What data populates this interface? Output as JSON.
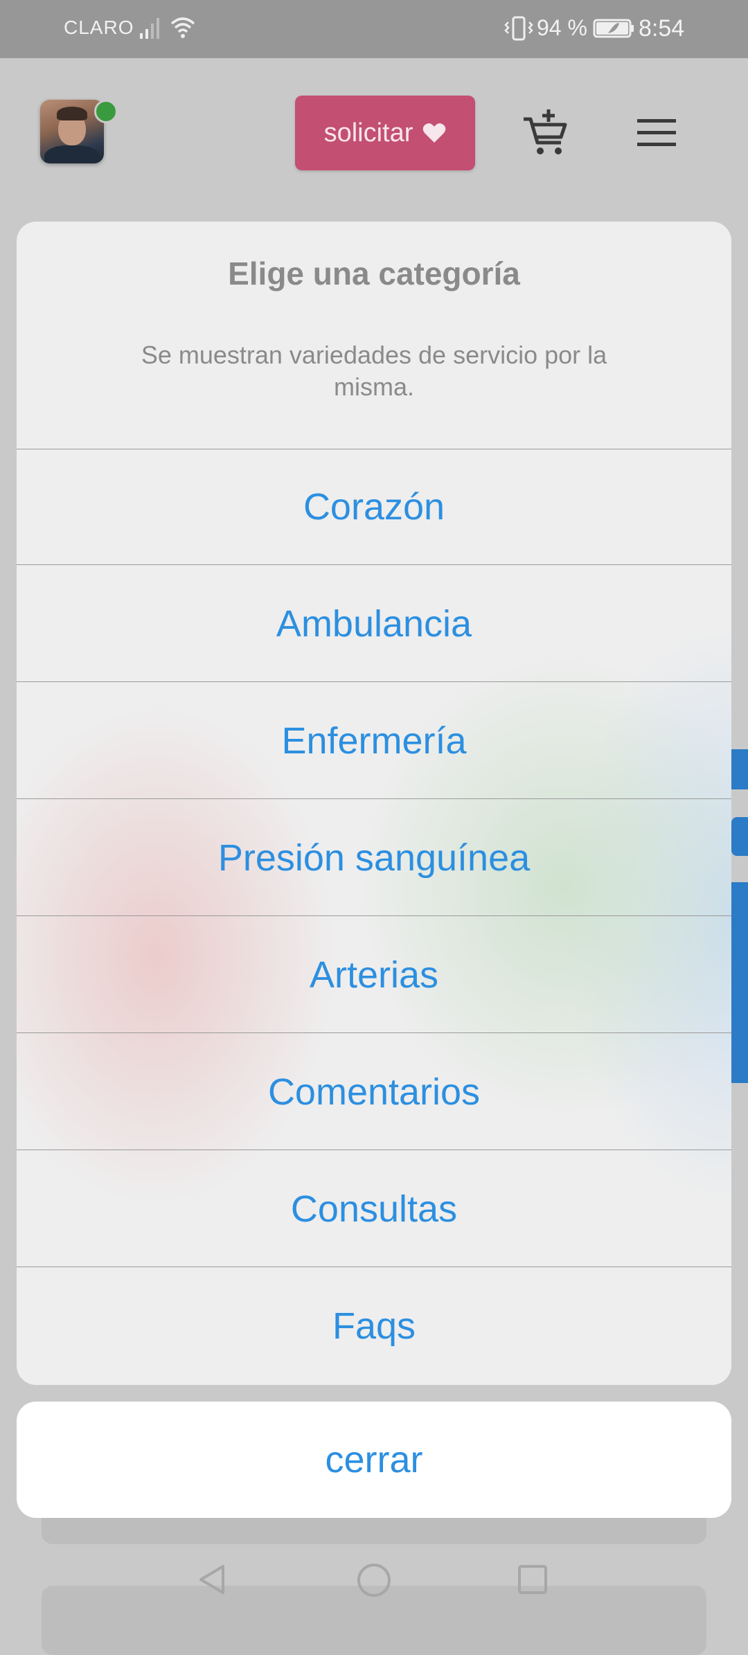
{
  "status_bar": {
    "carrier": "CLARO",
    "battery_percent": "94 %",
    "time": "8:54",
    "icons": [
      "signal-icon",
      "wifi-icon",
      "vibrate-icon",
      "battery-icon"
    ]
  },
  "header": {
    "request_button_label": "solicitar",
    "icons": [
      "avatar",
      "online-status-dot",
      "heart-icon",
      "add-to-cart-icon",
      "menu-icon"
    ],
    "colors": {
      "request_button": "#c34f73",
      "online_dot": "#3a9a3f"
    }
  },
  "sheet": {
    "title": "Elige una categoría",
    "subtitle": "Se muestran variedades de servicio por la misma.",
    "options": [
      {
        "label": "Corazón"
      },
      {
        "label": "Ambulancia"
      },
      {
        "label": "Enfermería"
      },
      {
        "label": "Presión sanguínea"
      },
      {
        "label": "Arterias"
      },
      {
        "label": "Comentarios"
      },
      {
        "label": "Consultas"
      },
      {
        "label": "Faqs"
      }
    ],
    "close_label": "cerrar",
    "colors": {
      "option_text": "#2c8fe0"
    }
  },
  "nav_bar": {
    "icons": [
      "back-icon",
      "home-icon",
      "recent-apps-icon"
    ]
  }
}
